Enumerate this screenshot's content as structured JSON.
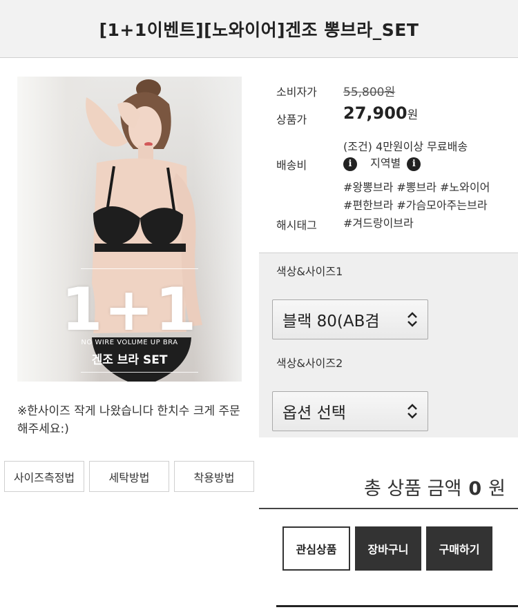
{
  "header": {
    "title": "[1+1이벤트][노와이어]겐조 뽕브라_SET"
  },
  "image": {
    "overlay_big": "1+1",
    "overlay_small": "NO WIRE VOLUME UP BRA",
    "overlay_sub": "겐조 브라 SET"
  },
  "note": "※한사이즈 작게 나왔습니다 한치수 크게 주문해주세요:)",
  "tabs": [
    {
      "label": "사이즈측정법"
    },
    {
      "label": "세탁방법"
    },
    {
      "label": "착용방법"
    }
  ],
  "info": {
    "consumer_price_label": "소비자가",
    "consumer_price_value": "55,800원",
    "price_label": "상품가",
    "price_value": "27,900",
    "price_unit": "원",
    "shipping_label": "배송비",
    "shipping_line1": "(조건) 4만원이상 무료배송",
    "shipping_region": "지역별",
    "hashtag_label": "해시태그",
    "hashtags": "#왕뽕브라 #뽕브라 #노와이어 #편한브라 #가슴모아주는브라 #겨드랑이브라"
  },
  "options": {
    "option1_label": "색상&사이즈1",
    "option1_value": "블랙 80(AB겸",
    "option2_label": "색상&사이즈2",
    "option2_value": "옵션 선택"
  },
  "total": {
    "label": "총 상품 금액",
    "amount": "0",
    "unit": "원"
  },
  "actions": {
    "wishlist": "관심상품",
    "cart": "장바구니",
    "buy": "구매하기"
  },
  "colors": {
    "panel_bg": "#efefef",
    "dark_button": "#333333",
    "header_bg": "#f2f2f2"
  },
  "icons": {
    "info": "info-icon",
    "select_arrow": "chevron-up-down-icon"
  }
}
